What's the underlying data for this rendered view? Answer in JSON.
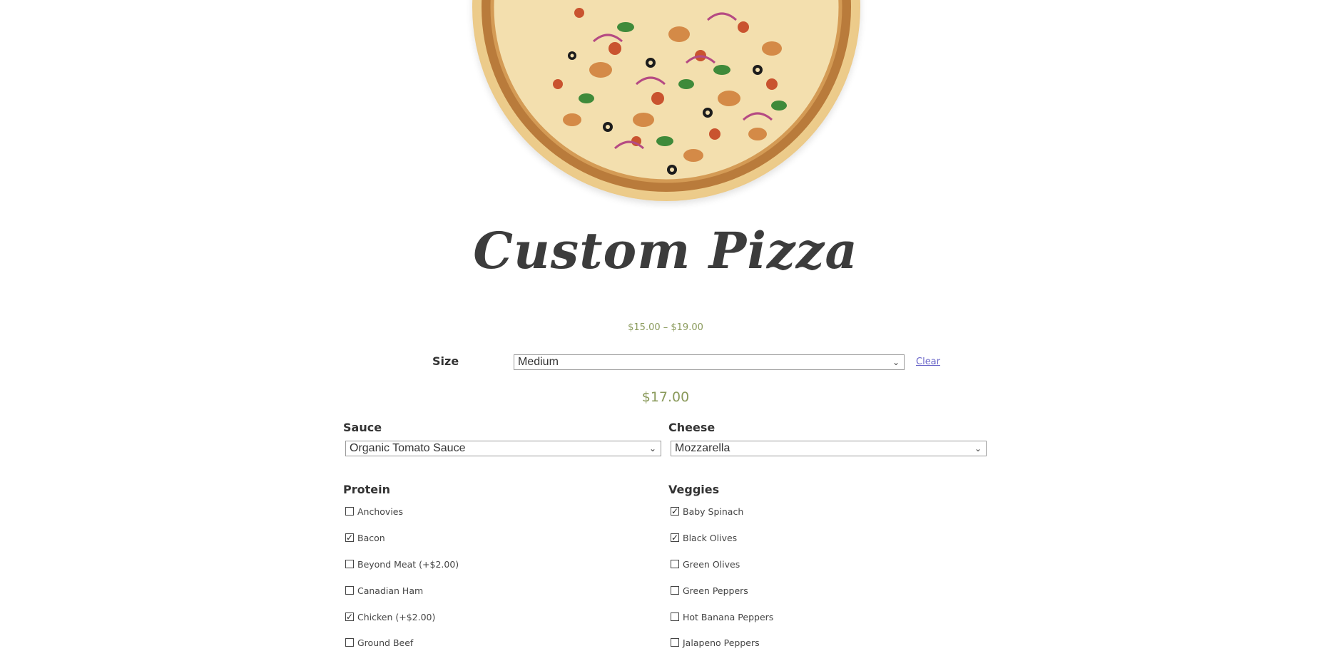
{
  "product": {
    "title": "Custom Pizza",
    "price_range": "$15.00 – $19.00",
    "current_price": "$17.00"
  },
  "size": {
    "label": "Size",
    "selected": "Medium",
    "clear_label": "Clear"
  },
  "sauce": {
    "label": "Sauce",
    "selected": "Organic Tomato Sauce"
  },
  "cheese": {
    "label": "Cheese",
    "selected": "Mozzarella"
  },
  "protein": {
    "label": "Protein",
    "options": [
      {
        "label": "Anchovies",
        "checked": false
      },
      {
        "label": "Bacon",
        "checked": true
      },
      {
        "label": "Beyond Meat (+$2.00)",
        "checked": false
      },
      {
        "label": "Canadian Ham",
        "checked": false
      },
      {
        "label": "Chicken (+$2.00)",
        "checked": true
      },
      {
        "label": "Ground Beef",
        "checked": false
      }
    ]
  },
  "veggies": {
    "label": "Veggies",
    "options": [
      {
        "label": "Baby Spinach",
        "checked": true
      },
      {
        "label": "Black Olives",
        "checked": true
      },
      {
        "label": "Green Olives",
        "checked": false
      },
      {
        "label": "Green Peppers",
        "checked": false
      },
      {
        "label": "Hot Banana Peppers",
        "checked": false
      },
      {
        "label": "Jalapeno Peppers",
        "checked": false
      }
    ]
  },
  "colors": {
    "price": "#8a9a5b",
    "link": "#6a66c9",
    "title": "#3c3c3c"
  }
}
